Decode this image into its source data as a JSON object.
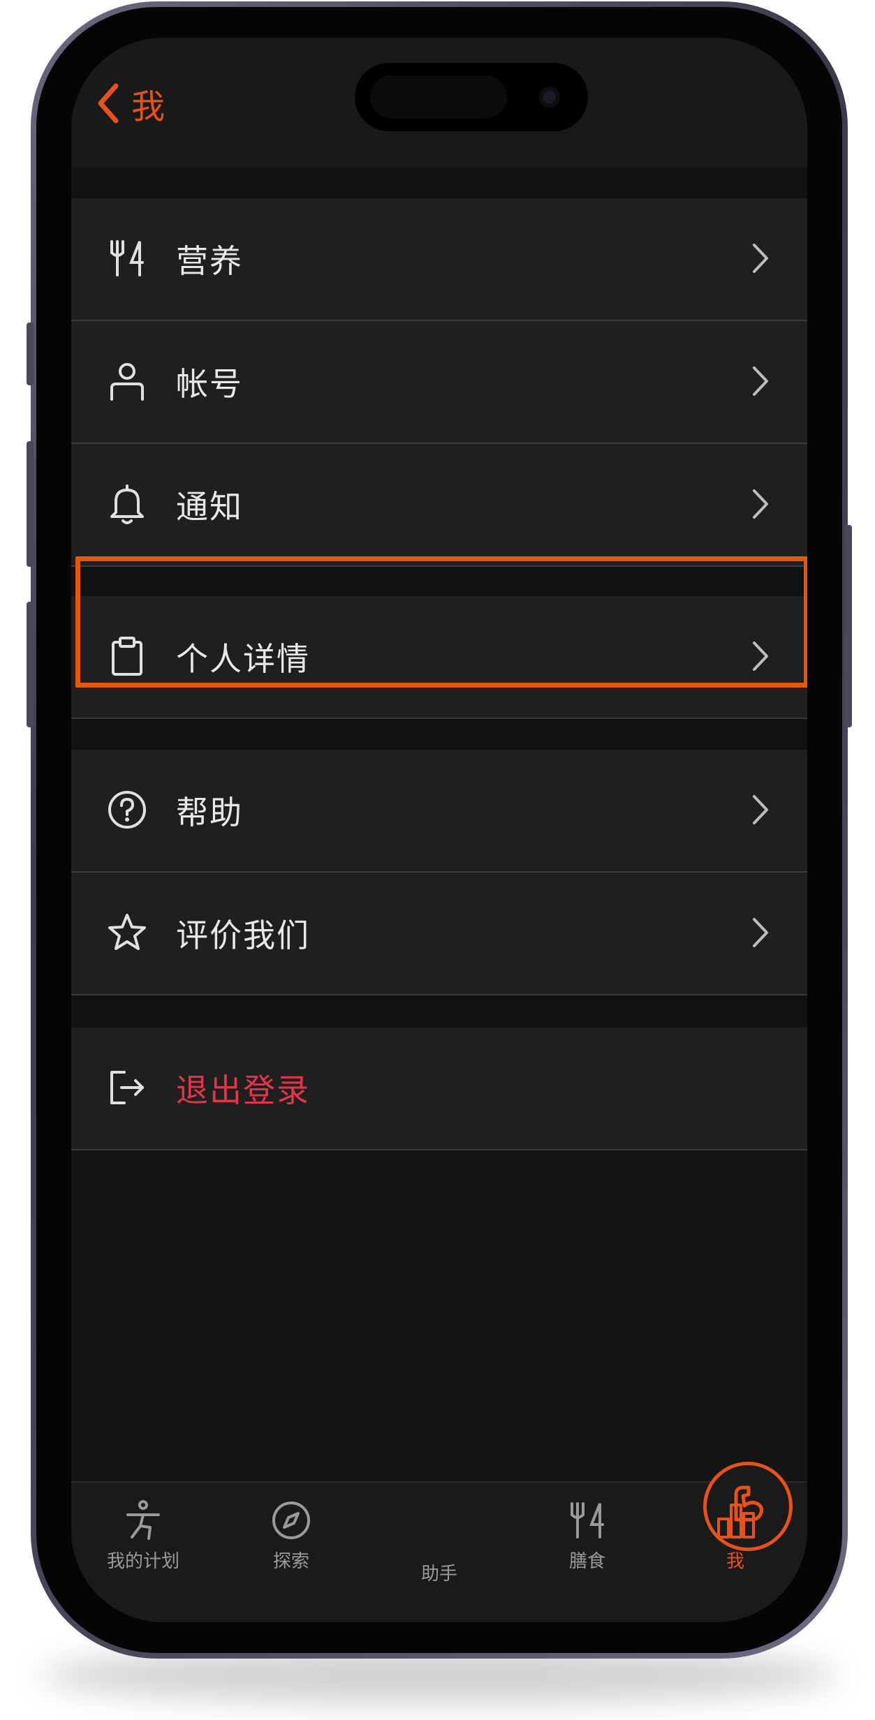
{
  "header": {
    "back_label": "我"
  },
  "menu_group_1": [
    {
      "label": "营养",
      "icon": "fork-knife-icon"
    },
    {
      "label": "帐号",
      "icon": "person-icon"
    },
    {
      "label": "通知",
      "icon": "bell-icon"
    }
  ],
  "menu_group_2": [
    {
      "label": "个人详情",
      "icon": "clipboard-icon"
    }
  ],
  "menu_group_3": [
    {
      "label": "帮助",
      "icon": "question-circle-icon"
    },
    {
      "label": "评价我们",
      "icon": "star-icon"
    }
  ],
  "logout": {
    "label": "退出登录",
    "icon": "logout-icon"
  },
  "tabbar": {
    "items": [
      {
        "label": "我的计划",
        "icon": "workout-figure-icon"
      },
      {
        "label": "探索",
        "icon": "compass-icon"
      },
      {
        "label": "助手",
        "icon": "muscle-arm-icon"
      },
      {
        "label": "膳食",
        "icon": "fork-knife-icon"
      },
      {
        "label": "我",
        "icon": "bar-chart-icon"
      }
    ],
    "active_index": 4
  },
  "colors": {
    "accent": "#e6521b",
    "logout": "#e0354b",
    "highlight": "#e3570f",
    "row_bg": "#1f1f1f",
    "background": "#141414"
  }
}
